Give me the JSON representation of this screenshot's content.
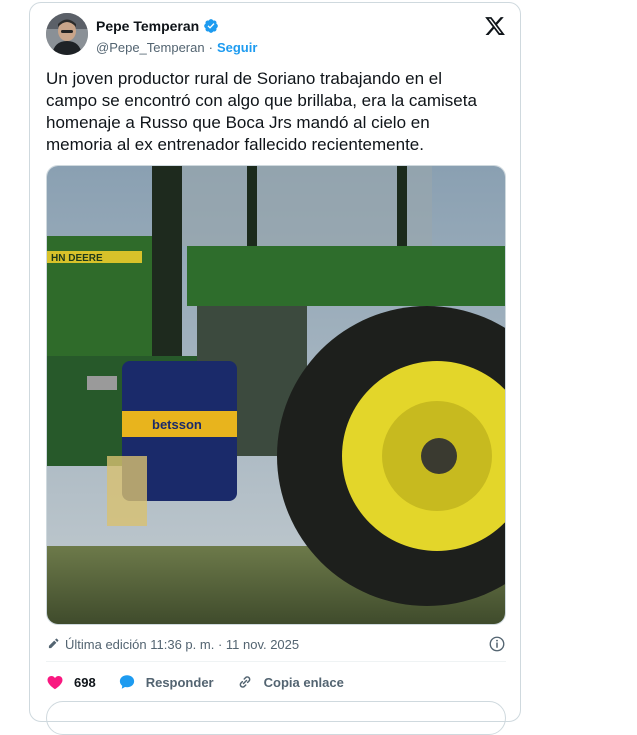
{
  "tweet": {
    "author": {
      "display_name": "Pepe Temperan",
      "handle": "@Pepe_Temperan",
      "separator": "·",
      "follow_label": "Seguir",
      "verified": true
    },
    "text": "Un joven productor rural de Soriano trabajando en el campo se encontró con algo que brillaba, era la camiseta homenaje a Russo que Boca Jrs mandó al cielo en memoria al ex entrenador fallecido recientemente.",
    "media": {
      "description_icon": "photo",
      "tractor_brand_text": "HN DEERE",
      "shirt_sponsor_text": "betsson"
    },
    "meta": {
      "edited_text": "Última edición 11:36 p. m. · 11 nov. 2025"
    },
    "actions": {
      "like_count": "698",
      "reply_label": "Responder",
      "copy_link_label": "Copia enlace"
    }
  },
  "colors": {
    "accent": "#1d9bf0",
    "like": "#f91880",
    "text": "#0f1419",
    "muted": "#536471",
    "border": "#cfd9de"
  }
}
